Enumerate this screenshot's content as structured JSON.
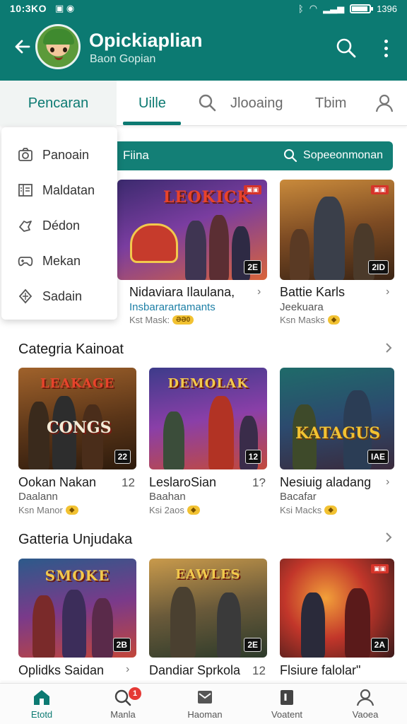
{
  "status_bar": {
    "time": "10:3KO",
    "clock_right": "1396",
    "battery_level": 0.9
  },
  "app_bar": {
    "title": "Opickiaplian",
    "subtitle": "Baon Gopian"
  },
  "tabs": [
    {
      "label": "Pencaran"
    },
    {
      "label": "Uille"
    },
    {
      "label": "Jlooaing"
    },
    {
      "label": "Tbim"
    }
  ],
  "menu": {
    "items": [
      {
        "label": "Panoain"
      },
      {
        "label": "Maldatan"
      },
      {
        "label": "Dédon"
      },
      {
        "label": "Mekan"
      },
      {
        "label": "Sadain"
      }
    ]
  },
  "filter_bar": {
    "label": "Fiina",
    "search_label": "Sopeeonmonan"
  },
  "row1": [
    {
      "art": "LEOKICK",
      "badge": "2E",
      "title": "Nidaviara Ilaulana,",
      "sub": "Insbararartamants",
      "meta": "Kst Mask:",
      "coin": "ƏƏ0"
    },
    {
      "art": "",
      "badge": "2ID",
      "title": "Battie Karls",
      "sub": "Jeekuara",
      "meta": "Ksn Masks",
      "coin": "◆"
    }
  ],
  "section1": {
    "title": "Categria Kainoat"
  },
  "row2": [
    {
      "art": "LEAKAGE",
      "art2": "CONGS",
      "badge": "22",
      "title": "Ookan Nakan",
      "num": "12",
      "sub": "Daalann",
      "meta": "Ksn Manor",
      "coin": "◆"
    },
    {
      "art": "DEMOLAK",
      "badge": "12",
      "title": "LeslaroSian",
      "num": "1?",
      "sub": "Baahan",
      "meta": "Ksi 2aos",
      "coin": "◆"
    },
    {
      "art": "KATAGUS",
      "badge": "IAE",
      "title": "Nesiuig aladang",
      "sub": "Bacafar",
      "meta": "Ksi Macks",
      "coin": "◆"
    }
  ],
  "section2": {
    "title": "Gatteria Unjudaka"
  },
  "row3": [
    {
      "art": "SMOKE",
      "badge": "2B",
      "title": "Oplidks Saidan"
    },
    {
      "art": "EAWLES",
      "badge": "2E",
      "title": "Dandiar Sprkola",
      "num": "12"
    },
    {
      "art": "",
      "badge": "2A",
      "title": "Flsiure falolar\""
    }
  ],
  "bottom_nav": [
    {
      "label": "Etotd"
    },
    {
      "label": "Manla",
      "badge": "1"
    },
    {
      "label": "Haoman"
    },
    {
      "label": "Voatent"
    },
    {
      "label": "Vaoea"
    }
  ],
  "colors": {
    "primary": "#0c7a72",
    "filter": "#137f76",
    "badge_red": "#e53935"
  }
}
